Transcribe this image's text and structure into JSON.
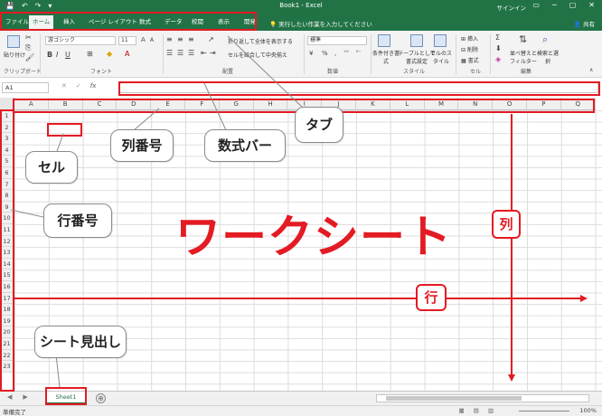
{
  "titlebar": {
    "title": "Book1 - Excel",
    "signin": "サインイン",
    "qat": [
      "💾",
      "↶",
      "↷",
      "▾"
    ],
    "winctl": [
      "▭",
      "─",
      "▢",
      "✕"
    ]
  },
  "tabs": {
    "items": [
      {
        "label": "ファイル"
      },
      {
        "label": "ホーム"
      },
      {
        "label": "挿入"
      },
      {
        "label": "ページ レイアウト"
      },
      {
        "label": "数式"
      },
      {
        "label": "データ"
      },
      {
        "label": "校閲"
      },
      {
        "label": "表示"
      },
      {
        "label": "開発"
      }
    ],
    "active": "ホーム",
    "tellme": "実行したい作業を入力してください",
    "share": "共有"
  },
  "ribbon": {
    "clipboard": {
      "label": "クリップボード",
      "paste": "貼り付け"
    },
    "font": {
      "label": "フォント",
      "name": "游ゴシック",
      "size": "11"
    },
    "alignment": {
      "label": "配置",
      "wrap": "折り返して全体を表示する",
      "merge": "セルを結合して中央揃え"
    },
    "number": {
      "label": "数値",
      "format": "標準"
    },
    "styles": {
      "label": "スタイル",
      "cond": "条件付き書式",
      "table": "テーブルとして書式設定",
      "cell": "セルのスタイル"
    },
    "cells": {
      "label": "セル",
      "insert": "挿入",
      "delete": "削除",
      "format": "書式"
    },
    "editing": {
      "label": "編集",
      "sort": "並べ替えとフィルター",
      "find": "検索と選択"
    }
  },
  "formula_bar": {
    "name_box": "A1",
    "fx": "fx",
    "cancel": "✕",
    "enter": "✓",
    "value": ""
  },
  "grid": {
    "columns": [
      "A",
      "B",
      "C",
      "D",
      "E",
      "F",
      "G",
      "H",
      "I",
      "J",
      "K",
      "L",
      "M",
      "N",
      "O",
      "P",
      "Q"
    ],
    "rows": [
      "1",
      "2",
      "3",
      "4",
      "5",
      "6",
      "7",
      "8",
      "9",
      "10",
      "11",
      "12",
      "13",
      "14",
      "15",
      "16",
      "17",
      "18",
      "19",
      "20",
      "21",
      "22",
      "23"
    ]
  },
  "sheets": {
    "tabs": [
      "Sheet1"
    ],
    "active": "Sheet1",
    "add": "⊕"
  },
  "statusbar": {
    "ready": "準備完了",
    "zoom": "100%"
  },
  "annotations": {
    "worksheet": "ワークシート",
    "cell": "セル",
    "column_number": "列番号",
    "formula_bar": "数式バー",
    "tab": "タブ",
    "row_number": "行番号",
    "sheet_tab": "シート見出し",
    "column": "列",
    "row": "行"
  },
  "colors": {
    "excel_green": "#217346",
    "annotation_red": "#e31b23"
  }
}
